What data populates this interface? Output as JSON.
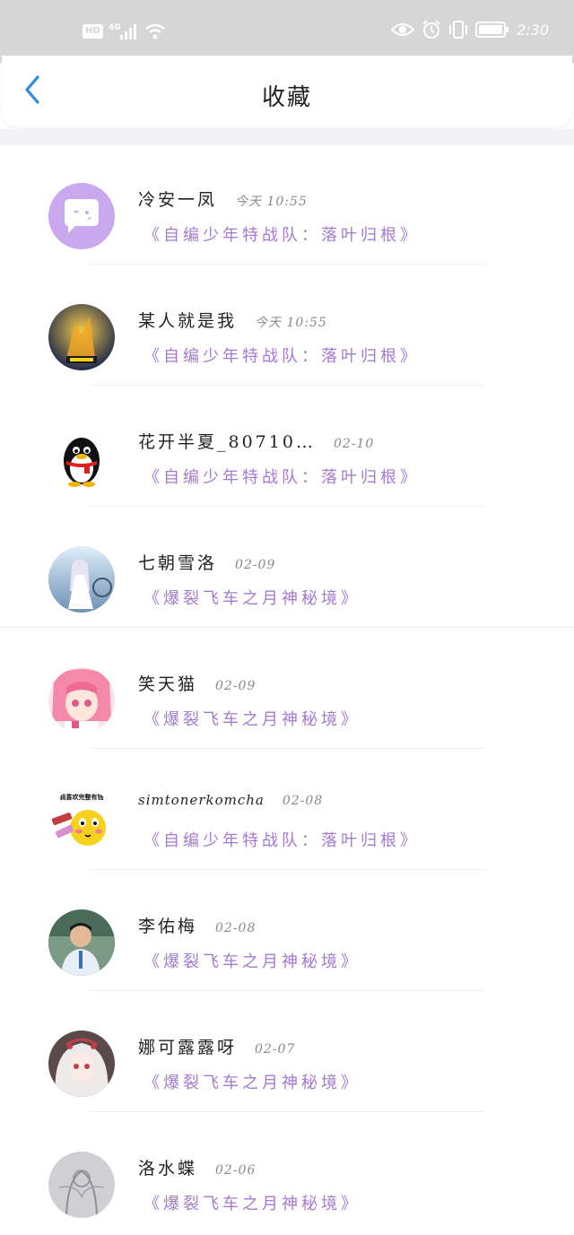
{
  "status_bar": {
    "hd": "HD",
    "network": "4G",
    "time": "2:30",
    "icons": [
      "hd-icon",
      "signal-icon",
      "wifi-icon",
      "eye-icon",
      "alarm-icon",
      "vibrate-icon",
      "battery-icon"
    ]
  },
  "header": {
    "title": "收藏",
    "back_icon": "chevron-left-icon",
    "accent": "#2a8be0"
  },
  "colors": {
    "work_title": "#a47ad0",
    "name": "#222222",
    "time": "#888888"
  },
  "favorites": [
    {
      "name": "冷安一凤",
      "time": "今天 10:55",
      "work": "《自编少年特战队：落叶归根》",
      "avatar": "chat-bubble-avatar"
    },
    {
      "name": "某人就是我",
      "time": "今天 10:55",
      "work": "《自编少年特战队：落叶归根》",
      "avatar": "photo-avatar"
    },
    {
      "name": "花开半夏_80710…",
      "time": "02-10",
      "work": "《自编少年特战队：落叶归根》",
      "avatar": "penguin-avatar"
    },
    {
      "name": "七朝雪洛",
      "time": "02-09",
      "work": "《爆裂飞车之月神秘境》",
      "avatar": "anime-girl-avatar"
    },
    {
      "name": "笑天猫",
      "time": "02-09",
      "work": "《爆裂飞车之月神秘境》",
      "avatar": "anime-pink-avatar"
    },
    {
      "name": "simtonerkomcha",
      "time": "02-08",
      "work": "《自编少年特战队：落叶归根》",
      "avatar": "emoji-avatar",
      "avatar_text": "我喜欢完整有钱"
    },
    {
      "name": "李佑梅",
      "time": "02-08",
      "work": "《爆裂飞车之月神秘境》",
      "avatar": "person-photo-avatar"
    },
    {
      "name": "娜可露露呀",
      "time": "02-07",
      "work": "《爆裂飞车之月神秘境》",
      "avatar": "anime-white-avatar"
    },
    {
      "name": "洛水蝶",
      "time": "02-06",
      "work": "《爆裂飞车之月神秘境》",
      "avatar": "sketch-avatar"
    }
  ]
}
